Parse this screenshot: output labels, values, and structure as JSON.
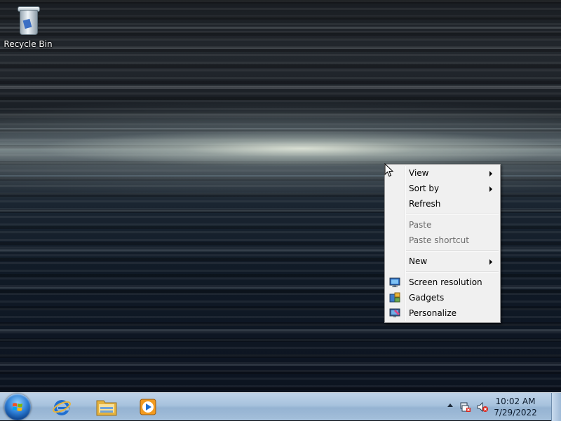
{
  "desktop": {
    "icons": [
      {
        "label": "Recycle Bin",
        "icon": "recycle-bin-icon"
      }
    ]
  },
  "context_menu": {
    "items": [
      {
        "label": "View",
        "submenu": true,
        "enabled": true
      },
      {
        "label": "Sort by",
        "submenu": true,
        "enabled": true
      },
      {
        "label": "Refresh",
        "submenu": false,
        "enabled": true
      },
      {
        "label": "Paste",
        "submenu": false,
        "enabled": false
      },
      {
        "label": "Paste shortcut",
        "submenu": false,
        "enabled": false
      },
      {
        "label": "New",
        "submenu": true,
        "enabled": true
      },
      {
        "label": "Screen resolution",
        "submenu": false,
        "enabled": true,
        "icon": "screen-resolution-icon"
      },
      {
        "label": "Gadgets",
        "submenu": false,
        "enabled": true,
        "icon": "gadgets-icon"
      },
      {
        "label": "Personalize",
        "submenu": false,
        "enabled": true,
        "icon": "personalize-icon"
      }
    ]
  },
  "taskbar": {
    "start_icon": "windows-start-orb-icon",
    "pinned": [
      {
        "icon": "internet-explorer-icon"
      },
      {
        "icon": "windows-explorer-icon"
      },
      {
        "icon": "windows-media-player-icon"
      }
    ],
    "tray": {
      "icons": [
        "show-hidden-icons-chevron-icon",
        "network-icon",
        "volume-muted-icon"
      ],
      "time": "10:02 AM",
      "date": "7/29/2022"
    }
  },
  "colors": {
    "taskbar": "#a7c2dd",
    "menu_background": "#f0f0f0",
    "menu_border": "#979797",
    "disabled_text": "#6d6d6d"
  }
}
